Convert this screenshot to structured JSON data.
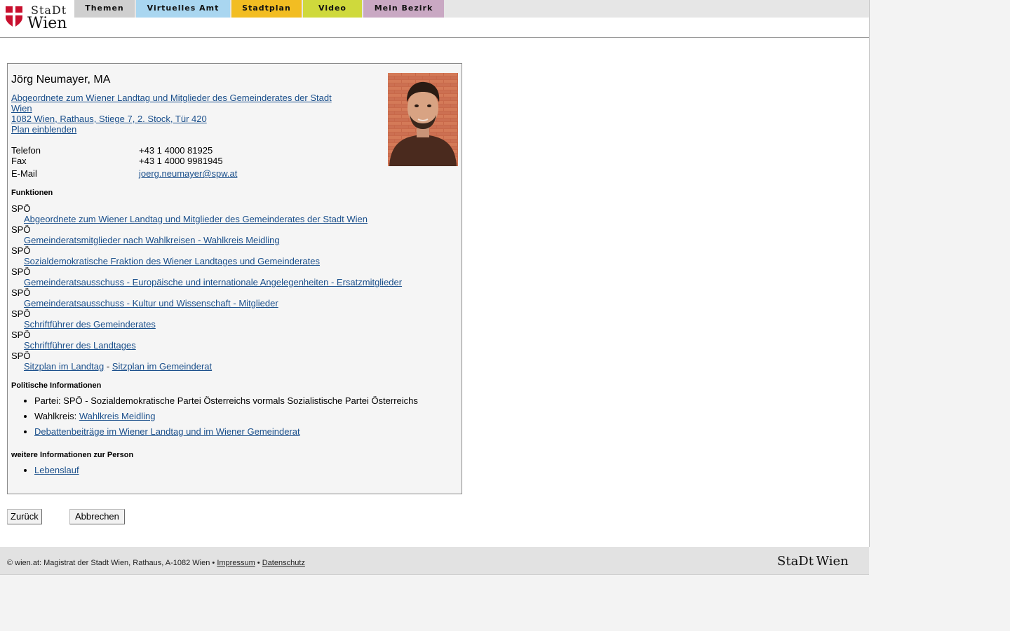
{
  "logo": {
    "line1": "StaDt",
    "line2": "Wien"
  },
  "nav": {
    "tabs": [
      {
        "label": "Themen",
        "color": "#cfcfcf"
      },
      {
        "label": "Virtuelles Amt",
        "color": "#a9d6f0"
      },
      {
        "label": "Stadtplan",
        "color": "#f2bd22"
      },
      {
        "label": "Video",
        "color": "#cfd93c"
      },
      {
        "label": "Mein Bezirk",
        "color": "#c9a8c3"
      }
    ]
  },
  "person": {
    "name": "Jörg Neumayer, MA",
    "affiliation": "Abgeordnete zum Wiener Landtag und Mitglieder des Gemeinderates der Stadt Wien",
    "address": "1082 Wien, Rathaus, Stiege 7, 2. Stock, Tür 420",
    "plan_link": "Plan einblenden",
    "contact": {
      "telefon_label": "Telefon",
      "telefon": "+43 1 4000 81925",
      "fax_label": "Fax",
      "fax": "+43 1 4000 9981945",
      "email_label": "E-Mail",
      "email": "joerg.neumayer@spw.at"
    }
  },
  "functions": {
    "title": "Funktionen",
    "items": [
      {
        "party": "SPÖ",
        "link": "Abgeordnete zum Wiener Landtag und Mitglieder des Gemeinderates der Stadt Wien"
      },
      {
        "party": "SPÖ",
        "link": "Gemeinderatsmitglieder nach Wahlkreisen - Wahlkreis Meidling"
      },
      {
        "party": "SPÖ",
        "link": "Sozialdemokratische Fraktion des Wiener Landtages und Gemeinderates"
      },
      {
        "party": "SPÖ",
        "link": "Gemeinderatsausschuss - Europäische und internationale Angelegenheiten - Ersatzmitglieder"
      },
      {
        "party": "SPÖ",
        "link": "Gemeinderatsausschuss - Kultur und Wissenschaft - Mitglieder"
      },
      {
        "party": "SPÖ",
        "link": "Schriftführer des Gemeinderates"
      },
      {
        "party": "SPÖ",
        "link": "Schriftführer des Landtages"
      }
    ],
    "last_party": "SPÖ",
    "seat_landtag": "Sitzplan im Landtag",
    "seat_sep": "-",
    "seat_gemeinderat": "Sitzplan im Gemeinderat"
  },
  "political": {
    "title": "Politische Informationen",
    "party_text": "Partei: SPÖ - Sozialdemokratische Partei Österreichs vormals Sozialistische Partei Österreichs",
    "wahlkreis_label": "Wahlkreis:",
    "wahlkreis_link": "Wahlkreis Meidling",
    "debates_link": "Debattenbeiträge im Wiener Landtag und im Wiener Gemeinderat"
  },
  "more": {
    "title": "weitere Informationen zur Person",
    "lebenslauf": "Lebenslauf"
  },
  "buttons": {
    "back": "Zurück",
    "cancel": "Abbrechen"
  },
  "footer": {
    "text": "© wien.at: Magistrat der Stadt Wien, Rathaus, A-1082 Wien •",
    "impressum": "Impressum",
    "sep": "•",
    "datenschutz": "Datenschutz",
    "logo": "StaDt Wien"
  }
}
